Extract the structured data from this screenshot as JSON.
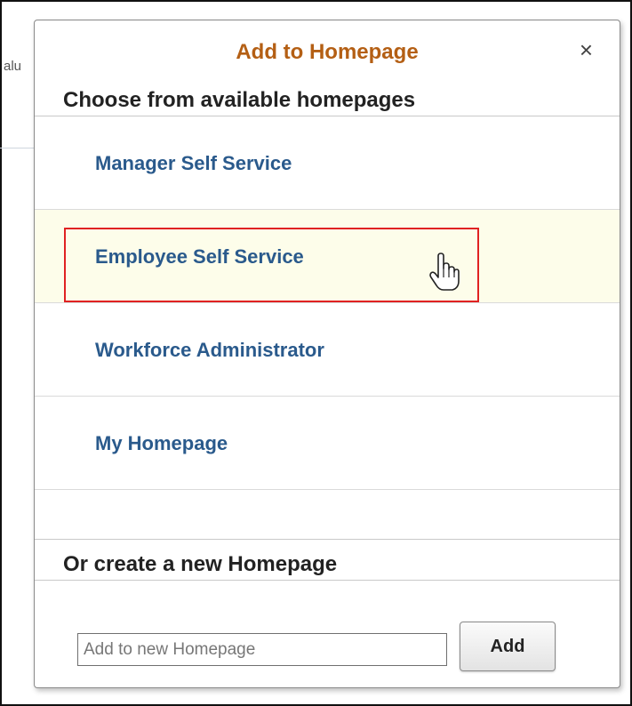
{
  "background": {
    "fragment_text": "alu"
  },
  "dialog": {
    "title": "Add to Homepage",
    "close_glyph": "×",
    "choose_heading": "Choose from available homepages",
    "homepages": [
      {
        "label": "Manager Self Service",
        "state": "normal"
      },
      {
        "label": "Employee Self Service",
        "state": "hover-highlighted"
      },
      {
        "label": "Workforce Administrator",
        "state": "normal"
      },
      {
        "label": "My Homepage",
        "state": "normal"
      }
    ],
    "create_heading": "Or create a new Homepage",
    "new_homepage_input": {
      "value": "",
      "placeholder": "Add to new Homepage"
    },
    "add_button_label": "Add"
  },
  "colors": {
    "title": "#b45f14",
    "link": "#2a5a8c",
    "hover_row": "#fdfdea",
    "highlight_box": "#e02222"
  },
  "icons": {
    "close": "close-icon",
    "cursor": "hand-pointer-icon"
  }
}
